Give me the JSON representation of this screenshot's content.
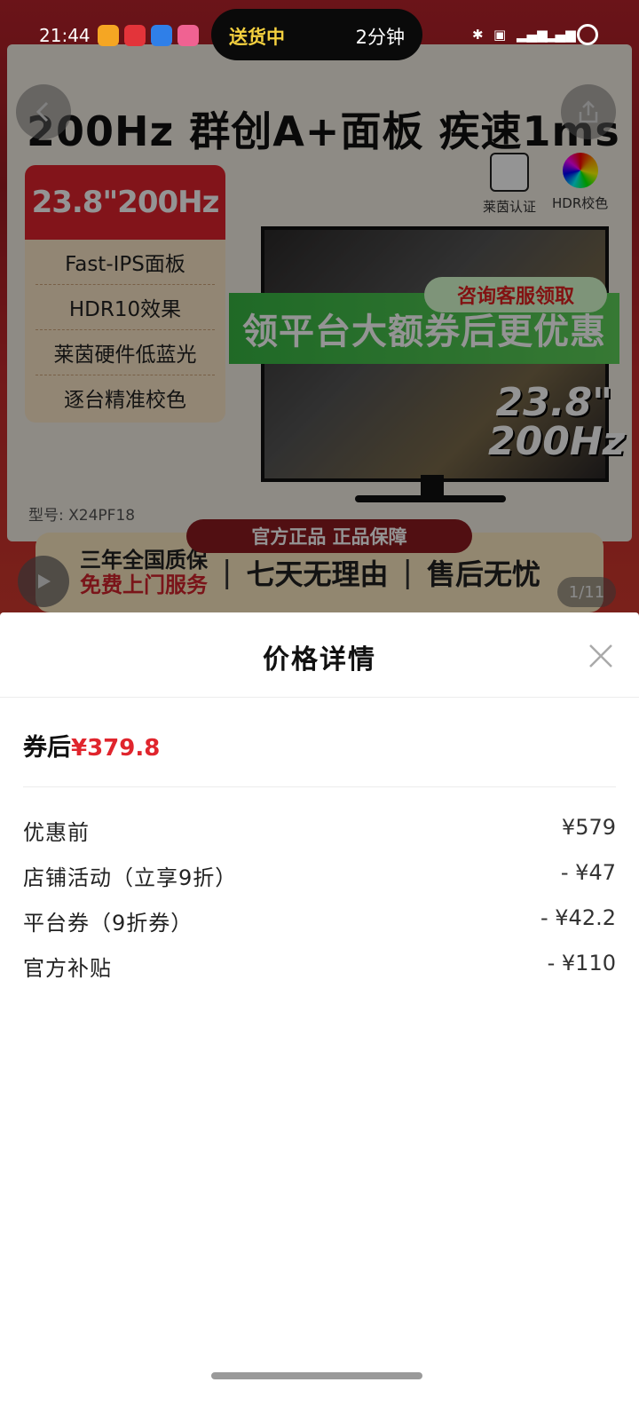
{
  "status_bar": {
    "time": "21:44",
    "delivery_status": "送货中",
    "delivery_eta": "2分钟"
  },
  "product_banner": {
    "headline": "200Hz 群创A+面板 疾速1ms",
    "spec_card": {
      "header": "23.8\"200Hz",
      "items": [
        "Fast-IPS面板",
        "HDR10效果",
        "莱茵硬件低蓝光",
        "逐台精准校色"
      ]
    },
    "certifications": [
      "莱茵认证",
      "HDR校色"
    ],
    "promo_pill": "咨询客服领取",
    "promo_band": "领平台大额券后更优惠",
    "size_tag": "23.8\" 200Hz",
    "model": "型号: X24PF18",
    "genuine_banner": "官方正品 正品保障",
    "warranty": {
      "line1": "三年全国质保",
      "line2": "免费上门服务",
      "point2": "七天无理由",
      "point3": "售后无忧"
    },
    "image_counter": "1/11"
  },
  "price_sheet": {
    "title": "价格详情",
    "summary_label": "券后",
    "summary_price": "¥379.8",
    "rows": [
      {
        "label": "优惠前",
        "value": "¥579"
      },
      {
        "label": "店铺活动（立享9折）",
        "value": "- ¥47"
      },
      {
        "label": "平台券（9折券）",
        "value": "- ¥42.2"
      },
      {
        "label": "官方补贴",
        "value": "- ¥110"
      }
    ]
  },
  "colors": {
    "accent_red": "#e0252d",
    "text_primary": "#111111",
    "overlay": "rgba(0,0,0,0.42)"
  }
}
